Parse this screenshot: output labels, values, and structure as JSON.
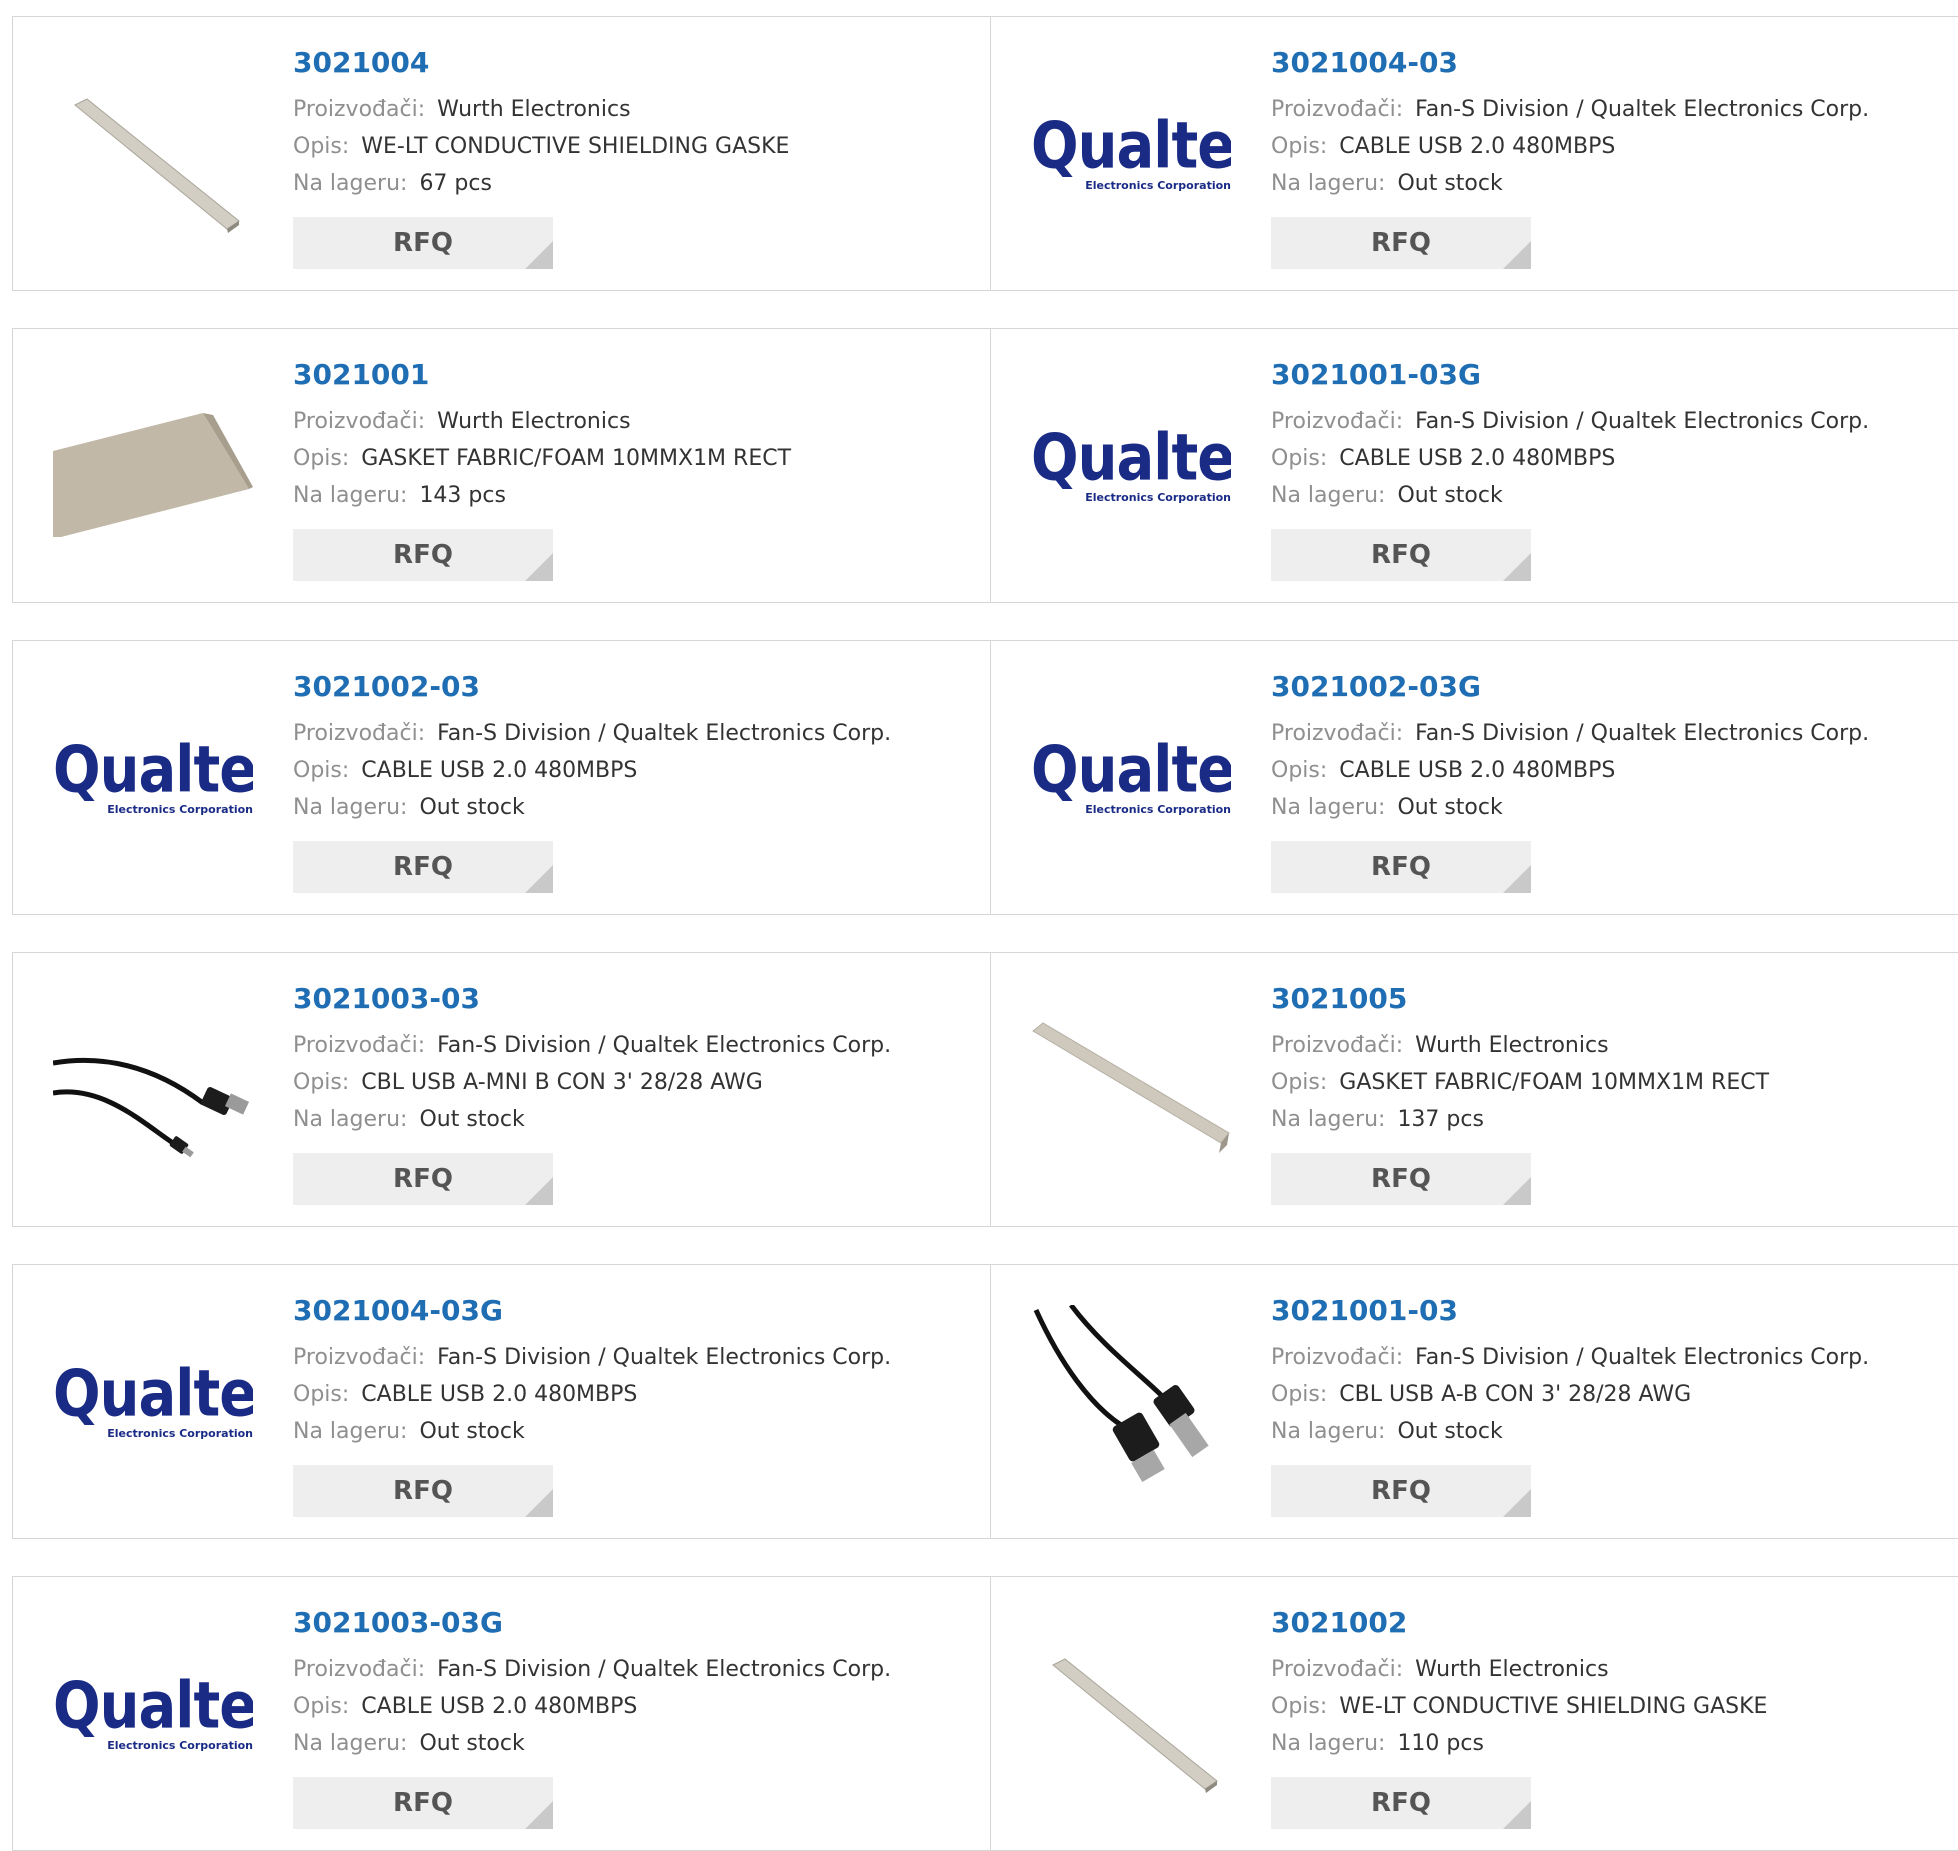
{
  "labels": {
    "manufacturer": "Proizvođači:",
    "description": "Opis:",
    "stock": "Na lageru:",
    "rfq": "RFQ"
  },
  "logo": {
    "big": "Qualtek",
    "small": "Electronics Corporation"
  },
  "products": [
    {
      "pn": "3021004",
      "mfr": "Wurth Electronics",
      "desc": "WE-LT CONDUCTIVE SHIELDING GASKE",
      "stock": "67 pcs",
      "image": "gasket-strip-image"
    },
    {
      "pn": "3021004-03",
      "mfr": "Fan-S Division / Qualtek Electronics Corp.",
      "desc": "CABLE USB 2.0 480MBPS",
      "stock": "Out stock",
      "image": "qualtek-logo"
    },
    {
      "pn": "3021001",
      "mfr": "Wurth Electronics",
      "desc": "GASKET FABRIC/FOAM 10MMX1M RECT",
      "stock": "143 pcs",
      "image": "gasket-foam-image"
    },
    {
      "pn": "3021001-03G",
      "mfr": "Fan-S Division / Qualtek Electronics Corp.",
      "desc": "CABLE USB 2.0 480MBPS",
      "stock": "Out stock",
      "image": "qualtek-logo"
    },
    {
      "pn": "3021002-03",
      "mfr": "Fan-S Division / Qualtek Electronics Corp.",
      "desc": "CABLE USB 2.0 480MBPS",
      "stock": "Out stock",
      "image": "qualtek-logo"
    },
    {
      "pn": "3021002-03G",
      "mfr": "Fan-S Division / Qualtek Electronics Corp.",
      "desc": "CABLE USB 2.0 480MBPS",
      "stock": "Out stock",
      "image": "qualtek-logo"
    },
    {
      "pn": "3021003-03",
      "mfr": "Fan-S Division / Qualtek Electronics Corp.",
      "desc": "CBL USB A-MNI B CON 3' 28/28 AWG",
      "stock": "Out stock",
      "image": "usb-mini-cable-image"
    },
    {
      "pn": "3021005",
      "mfr": "Wurth Electronics",
      "desc": "GASKET FABRIC/FOAM 10MMX1M RECT",
      "stock": "137 pcs",
      "image": "gasket-rod-image"
    },
    {
      "pn": "3021004-03G",
      "mfr": "Fan-S Division / Qualtek Electronics Corp.",
      "desc": "CABLE USB 2.0 480MBPS",
      "stock": "Out stock",
      "image": "qualtek-logo"
    },
    {
      "pn": "3021001-03",
      "mfr": "Fan-S Division / Qualtek Electronics Corp.",
      "desc": "CBL USB A-B CON 3' 28/28 AWG",
      "stock": "Out stock",
      "image": "usb-ab-cable-image"
    },
    {
      "pn": "3021003-03G",
      "mfr": "Fan-S Division / Qualtek Electronics Corp.",
      "desc": "CABLE USB 2.0 480MBPS",
      "stock": "Out stock",
      "image": "qualtek-logo"
    },
    {
      "pn": "3021002",
      "mfr": "Wurth Electronics",
      "desc": "WE-LT CONDUCTIVE SHIELDING GASKE",
      "stock": "110 pcs",
      "image": "gasket-strip-image"
    }
  ]
}
